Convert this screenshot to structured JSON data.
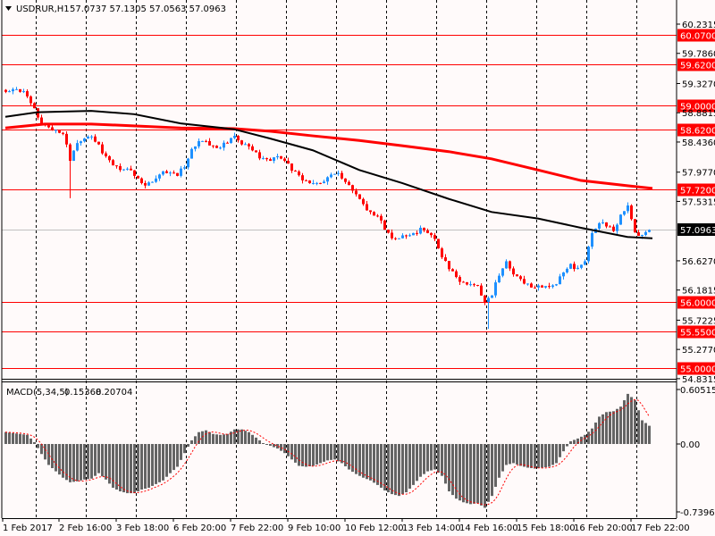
{
  "header": {
    "symbol": "USDRUR,H1",
    "ohlc": "57.0737 57.1305 57.0563 57.0963"
  },
  "macd_header": {
    "name": "MACD(5,34,5)",
    "main": "0.15368",
    "signal": "0.20704"
  },
  "colors": {
    "background": "#fffafa",
    "bull": "#1e90ff",
    "bear": "#ff0000",
    "level": "#ff0000",
    "ma_slow": "#000000",
    "ma_red": "#ff0000",
    "histogram": "#646464",
    "signal": "#ff0000"
  },
  "current_price": "57.0963",
  "price_ticks": [
    "60.2315",
    "59.7860",
    "59.3270",
    "58.8815",
    "58.4360",
    "57.9770",
    "57.5315",
    "56.6270",
    "56.1815",
    "55.7225",
    "55.2770",
    "54.8315"
  ],
  "levels": [
    "60.0700",
    "59.6200",
    "59.0000",
    "58.6200",
    "57.7200",
    "56.0000",
    "55.5500",
    "55.0000"
  ],
  "macd_ticks": [
    "0.60515",
    "0.00",
    "-0.73969"
  ],
  "time_labels": [
    "1 Feb 2017",
    "2 Feb 16:00",
    "3 Feb 18:00",
    "6 Feb 20:00",
    "7 Feb 22:00",
    "9 Feb 10:00",
    "10 Feb 12:00",
    "13 Feb 14:00",
    "14 Feb 16:00",
    "15 Feb 18:00",
    "16 Feb 20:00",
    "17 Feb 22:00"
  ],
  "chart_data": {
    "type": "candlestick",
    "title": "USDRUR,H1",
    "ylim": [
      54.8315,
      60.2315
    ],
    "closes_every_2_bars": [
      59.2,
      59.24,
      59.2,
      59.13,
      58.95,
      58.72,
      58.66,
      58.62,
      58.56,
      58.15,
      58.42,
      58.49,
      58.52,
      58.4,
      58.22,
      58.08,
      58.01,
      58.03,
      57.92,
      57.81,
      57.82,
      57.88,
      57.99,
      57.97,
      57.92,
      58.05,
      58.33,
      58.45,
      58.45,
      58.38,
      58.35,
      58.42,
      58.53,
      58.4,
      58.37,
      58.28,
      58.19,
      58.15,
      58.22,
      58.15,
      58.0,
      57.93,
      57.85,
      57.81,
      57.81,
      57.9,
      57.95,
      57.88,
      57.78,
      57.64,
      57.49,
      57.37,
      57.31,
      57.1,
      56.97,
      56.97,
      57.01,
      57.05,
      57.13,
      57.05,
      56.96,
      56.68,
      56.5,
      56.38,
      56.3,
      56.27,
      56.25,
      56.0,
      56.1,
      56.4,
      56.62,
      56.42,
      56.35,
      56.28,
      56.22,
      56.22,
      56.23,
      56.27,
      56.45,
      56.58,
      56.52,
      56.62,
      57.05,
      57.2,
      57.15,
      57.08,
      57.33,
      57.47,
      57.06,
      57.02,
      57.0963
    ],
    "spikes": [
      {
        "bar": 18,
        "low": 57.58
      },
      {
        "bar": 135,
        "low": 55.59
      }
    ],
    "ma_black": [
      [
        0,
        58.82
      ],
      [
        9,
        58.89
      ],
      [
        24,
        58.91
      ],
      [
        36,
        58.86
      ],
      [
        49,
        58.72
      ],
      [
        64,
        58.63
      ],
      [
        74,
        58.49
      ],
      [
        86,
        58.31
      ],
      [
        99,
        58.01
      ],
      [
        111,
        57.81
      ],
      [
        124,
        57.57
      ],
      [
        136,
        57.37
      ],
      [
        149,
        57.27
      ],
      [
        161,
        57.13
      ],
      [
        174,
        56.99
      ],
      [
        181,
        56.97
      ]
    ],
    "ma_red": [
      [
        0,
        58.65
      ],
      [
        11,
        58.71
      ],
      [
        24,
        58.71
      ],
      [
        49,
        58.65
      ],
      [
        64,
        58.64
      ],
      [
        74,
        58.6
      ],
      [
        86,
        58.53
      ],
      [
        99,
        58.46
      ],
      [
        111,
        58.38
      ],
      [
        124,
        58.29
      ],
      [
        136,
        58.18
      ],
      [
        149,
        58.01
      ],
      [
        161,
        57.85
      ],
      [
        174,
        57.77
      ],
      [
        181,
        57.73
      ]
    ],
    "macd": {
      "ylim": [
        -0.73969,
        0.60515
      ],
      "histogram_every_2_bars": [
        0.13,
        0.12,
        0.11,
        0.1,
        0.02,
        -0.11,
        -0.23,
        -0.3,
        -0.37,
        -0.42,
        -0.41,
        -0.39,
        -0.38,
        -0.32,
        -0.39,
        -0.48,
        -0.52,
        -0.54,
        -0.54,
        -0.5,
        -0.48,
        -0.44,
        -0.4,
        -0.32,
        -0.25,
        -0.1,
        0.04,
        0.13,
        0.15,
        0.11,
        0.1,
        0.11,
        0.16,
        0.16,
        0.13,
        0.07,
        0.01,
        -0.02,
        -0.05,
        -0.1,
        -0.17,
        -0.24,
        -0.25,
        -0.24,
        -0.21,
        -0.18,
        -0.17,
        -0.21,
        -0.28,
        -0.33,
        -0.37,
        -0.4,
        -0.45,
        -0.51,
        -0.55,
        -0.57,
        -0.53,
        -0.45,
        -0.36,
        -0.3,
        -0.28,
        -0.35,
        -0.52,
        -0.6,
        -0.64,
        -0.66,
        -0.65,
        -0.7,
        -0.57,
        -0.37,
        -0.23,
        -0.21,
        -0.24,
        -0.26,
        -0.27,
        -0.26,
        -0.25,
        -0.21,
        -0.08,
        0.03,
        0.06,
        0.1,
        0.17,
        0.3,
        0.35,
        0.36,
        0.41,
        0.55,
        0.48,
        0.26,
        0.2,
        0.15368
      ]
    }
  }
}
